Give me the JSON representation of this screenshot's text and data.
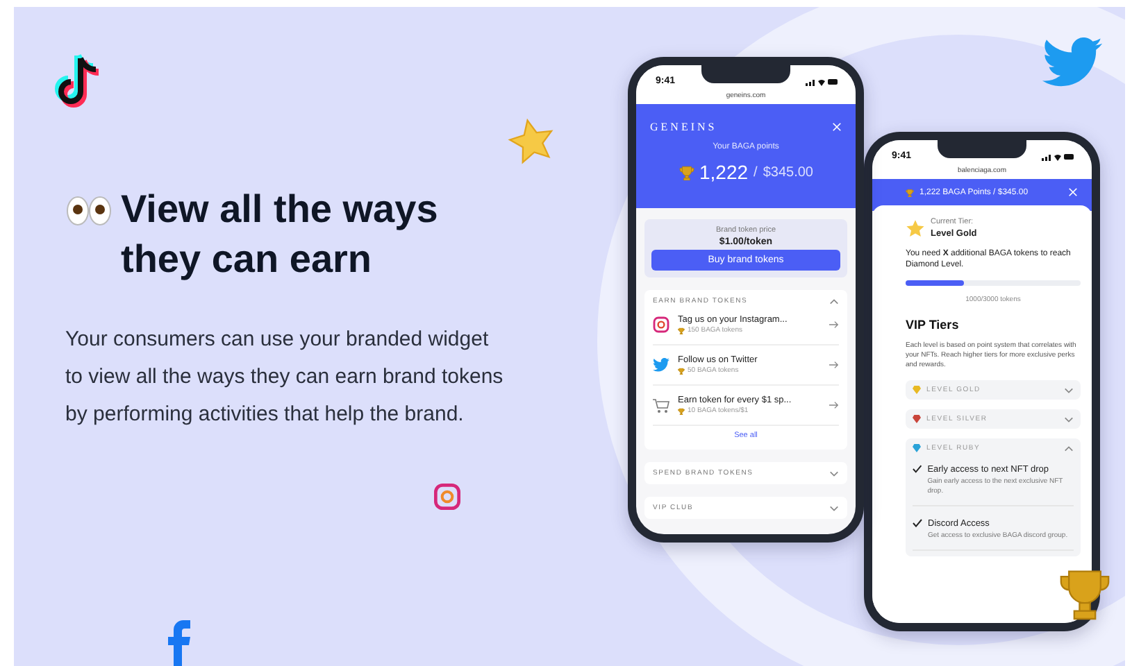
{
  "headline": "View all the ways they can earn",
  "description": "Your consumers can use your branded widget to view all the ways they can earn brand tokens by performing activities that help the brand.",
  "phone_main": {
    "time": "9:41",
    "url": "geneins.com",
    "brand": "GENEINS",
    "points_label": "Your BAGA points",
    "points": "1,222",
    "separator": "/",
    "amount": "$345.00",
    "price_label": "Brand token price",
    "price": "$1.00/token",
    "buy_button": "Buy brand tokens",
    "sections": [
      {
        "title": "EARN BRAND TOKENS",
        "expanded": true,
        "see_all": "See all",
        "items": [
          {
            "kind": "instagram",
            "title": "Tag us on your Instagram...",
            "reward": "150 BAGA tokens"
          },
          {
            "kind": "twitter",
            "title": "Follow us on Twitter",
            "reward": "50 BAGA tokens"
          },
          {
            "kind": "cart",
            "title": "Earn token for every $1 sp...",
            "reward": "10 BAGA tokens/$1"
          }
        ]
      },
      {
        "title": "SPEND BRAND TOKENS",
        "expanded": false
      },
      {
        "title": "VIP CLUB",
        "expanded": false
      }
    ]
  },
  "phone_tiers": {
    "time": "9:41",
    "url": "balenciaga.com",
    "header": "1,222 BAGA Points / $345.00",
    "current_tier_label": "Current Tier:",
    "current_tier": "Level Gold",
    "progress_text": "You need **X** additional BAGA tokens to reach Diamond Level.",
    "level": 0.33,
    "progress_label": "1000/3000 tokens",
    "vip_title": "VIP Tiers",
    "vip_description": "Each level is based on point system that correlates with your NFTs. Reach higher tiers for more exclusive perks and rewards.",
    "tiers": [
      {
        "kind": "gold",
        "name": "LEVEL GOLD",
        "expanded": false
      },
      {
        "kind": "silver",
        "name": "LEVEL SILVER",
        "expanded": false
      },
      {
        "kind": "ruby",
        "name": "LEVEL RUBY",
        "expanded": true,
        "perks": [
          {
            "title": "Early access to next NFT drop",
            "description": "Gain early access to the next exclusive NFT drop."
          },
          {
            "title": "Discord Access",
            "description": "Get access to exclusive BAGA discord group."
          }
        ]
      }
    ]
  }
}
